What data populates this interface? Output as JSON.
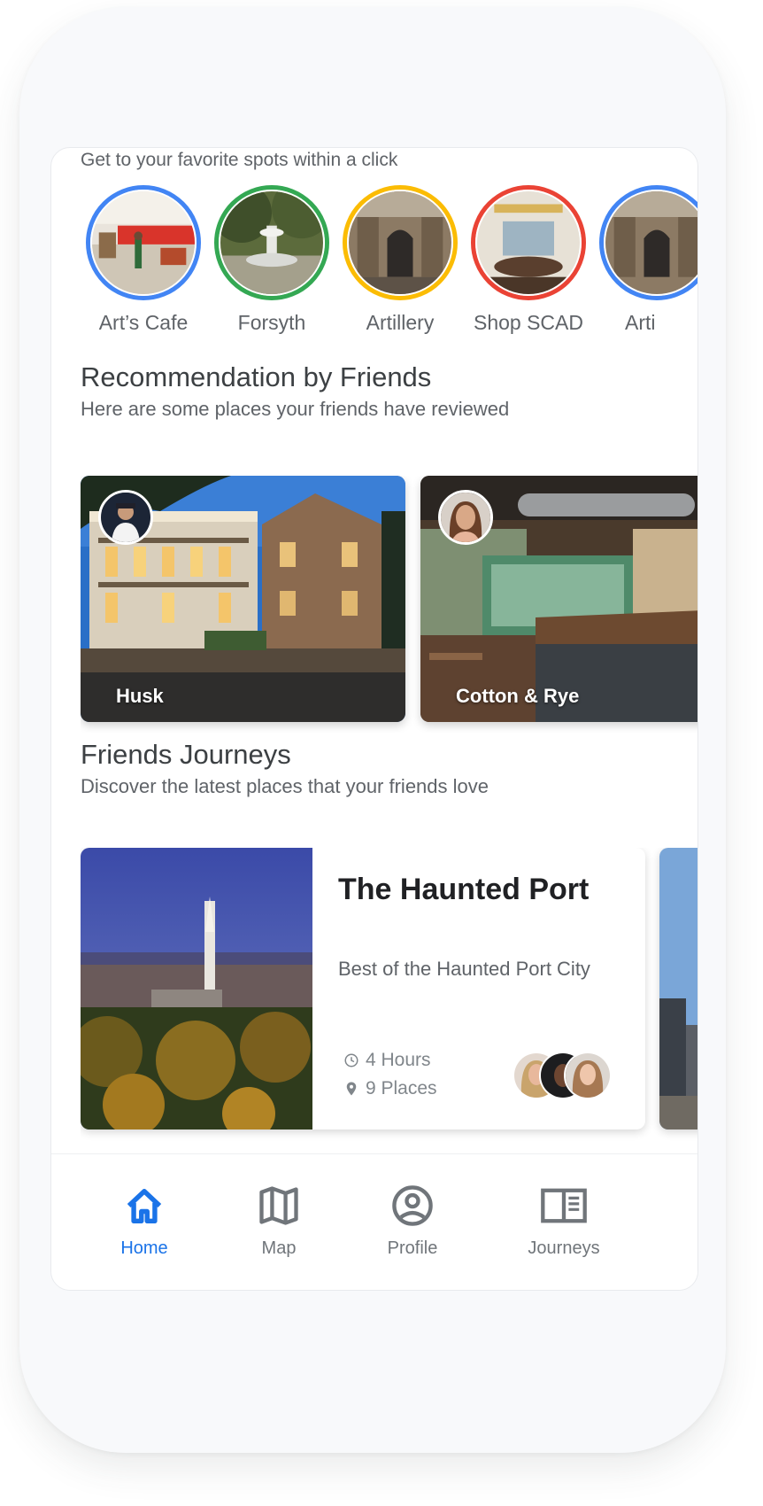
{
  "tagline": "Get to your favorite spots within a click",
  "spots": [
    {
      "label": "Art’s Cafe",
      "ring_color": "#4285f4"
    },
    {
      "label": "Forsyth",
      "ring_color": "#34a853"
    },
    {
      "label": "Artillery",
      "ring_color": "#fbbc04"
    },
    {
      "label": "Shop SCAD",
      "ring_color": "#ea4335"
    },
    {
      "label": "Arti",
      "ring_color": "#4285f4"
    }
  ],
  "recommendations": {
    "title": "Recommendation by Friends",
    "subtitle": "Here are some places your friends have reviewed",
    "cards": [
      {
        "name": "Husk"
      },
      {
        "name": "Cotton & Rye"
      }
    ]
  },
  "journeys": {
    "title": "Friends Journeys",
    "subtitle": "Discover the latest places that your friends love",
    "card": {
      "title": "The Haunted Port",
      "description": "Best of the Haunted Port City",
      "duration": "4 Hours",
      "places": "9 Places",
      "duration_icon": "clock-icon",
      "places_icon": "location-pin-icon"
    }
  },
  "nav": {
    "active_color": "#1a73e8",
    "items": [
      {
        "label": "Home",
        "icon": "home-icon",
        "active": true
      },
      {
        "label": "Map",
        "icon": "map-icon",
        "active": false
      },
      {
        "label": "Profile",
        "icon": "account-circle-icon",
        "active": false
      },
      {
        "label": "Journeys",
        "icon": "journeys-book-icon",
        "active": false
      }
    ]
  }
}
